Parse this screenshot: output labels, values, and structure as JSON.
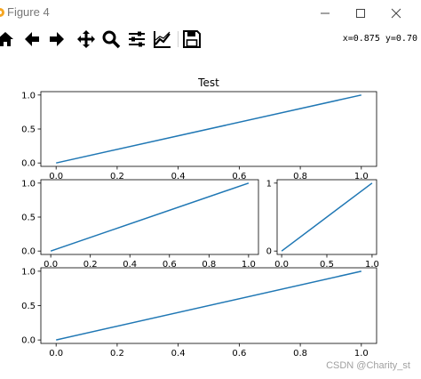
{
  "window": {
    "title": "Figure 4",
    "app_icon": "matplotlib-figure-icon",
    "controls": [
      "minimize-icon",
      "maximize-icon",
      "close-icon"
    ]
  },
  "toolbar": {
    "tools": [
      "home-icon",
      "back-arrow-icon",
      "forward-arrow-icon",
      "pan-move-icon",
      "zoom-magnifier-icon",
      "configure-subplots-icon",
      "edit-axis-lines-icon",
      "save-floppy-icon"
    ],
    "coords": "x=0.875 y=0.70"
  },
  "watermark": "CSDN @Charity_st",
  "colors": {
    "line": "#1f77b4",
    "axes": "#000000"
  },
  "chart_data": [
    {
      "type": "line",
      "title": "Test",
      "x": [
        0,
        1
      ],
      "y": [
        0,
        1
      ],
      "xlim": [
        -0.05,
        1.05
      ],
      "ylim": [
        -0.05,
        1.05
      ],
      "xticks": [
        "0.0",
        "0.2",
        "0.4",
        "0.6",
        "0.8",
        "1.0"
      ],
      "yticks": [
        "0.0",
        "0.5",
        "1.0"
      ],
      "grid": false
    },
    {
      "type": "line",
      "title": "",
      "x": [
        0,
        1
      ],
      "y": [
        0,
        1
      ],
      "xlim": [
        -0.05,
        1.05
      ],
      "ylim": [
        -0.05,
        1.05
      ],
      "xticks": [
        "0.0",
        "0.2",
        "0.4",
        "0.6",
        "0.8",
        "1.0"
      ],
      "yticks": [
        "0.0",
        "0.5",
        "1.0"
      ],
      "grid": false
    },
    {
      "type": "line",
      "title": "",
      "x": [
        0,
        1
      ],
      "y": [
        0,
        1
      ],
      "xlim": [
        -0.05,
        1.05
      ],
      "ylim": [
        -0.05,
        1.05
      ],
      "xticks": [
        "0.0",
        "0.5",
        "1.0"
      ],
      "yticks": [
        "0",
        "1"
      ],
      "grid": false
    },
    {
      "type": "line",
      "title": "",
      "x": [
        0,
        1
      ],
      "y": [
        0,
        1
      ],
      "xlim": [
        -0.05,
        1.05
      ],
      "ylim": [
        -0.05,
        1.05
      ],
      "xticks": [
        "0.0",
        "0.2",
        "0.4",
        "0.6",
        "0.8",
        "1.0"
      ],
      "yticks": [
        "0.0",
        "0.5",
        "1.0"
      ],
      "grid": false
    }
  ]
}
